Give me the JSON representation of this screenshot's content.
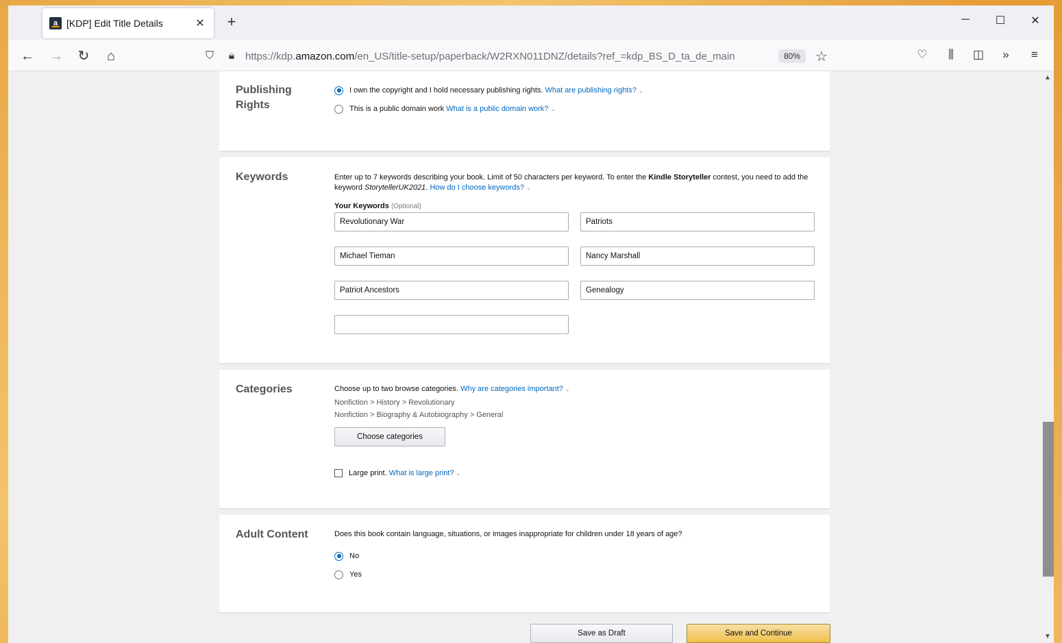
{
  "browser": {
    "tab_title": "[KDP] Edit Title Details",
    "tab_favicon": "a",
    "new_tab_label": "+",
    "url_prefix": "https://kdp.",
    "url_domain": "amazon.com",
    "url_path": "/en_US/title-setup/paperback/W2RXN011DNZ/details?ref_=kdp_BS_D_ta_de_main",
    "zoom": "80%"
  },
  "publishing_rights": {
    "label_line1": "Publishing",
    "label_line2": "Rights",
    "option1_text": "I own the copyright and I hold necessary publishing rights.",
    "option1_link": "What are publishing rights?",
    "option1_selected": true,
    "option2_text": "This is a public domain work",
    "option2_link": "What is a public domain work?",
    "option2_selected": false
  },
  "keywords": {
    "label": "Keywords",
    "desc_part1": "Enter up to 7 keywords describing your book. Limit of 50 characters per keyword. To enter the",
    "desc_bold": "Kindle Storyteller",
    "desc_part2": "contest, you need to add the keyword",
    "desc_italic": "StorytellerUK2021",
    "desc_link": "How do I choose keywords?",
    "your_keywords": "Your Keywords",
    "optional": "(Optional)",
    "values": [
      "Revolutionary War",
      "Patriots",
      "Michael Tieman",
      "Nancy Marshall",
      "Patriot Ancestors",
      "Genealogy",
      ""
    ]
  },
  "categories": {
    "label": "Categories",
    "intro": "Choose up to two browse categories.",
    "intro_link": "Why are categories important?",
    "cat1": "Nonfiction > History > Revolutionary",
    "cat2": "Nonfiction > Biography & Autobiography > General",
    "choose_button": "Choose categories",
    "large_print_text": "Large print.",
    "large_print_link": "What is large print?",
    "large_print_checked": false
  },
  "adult_content": {
    "label": "Adult Content",
    "question": "Does this book contain language, situations, or images inappropriate for children under 18 years of age?",
    "option_no": "No",
    "option_yes": "Yes",
    "selected": "No"
  },
  "footer": {
    "save_draft": "Save as Draft",
    "save_continue": "Save and Continue"
  },
  "colors": {
    "link": "#0066c0",
    "primary_button": "#f0c14b"
  }
}
